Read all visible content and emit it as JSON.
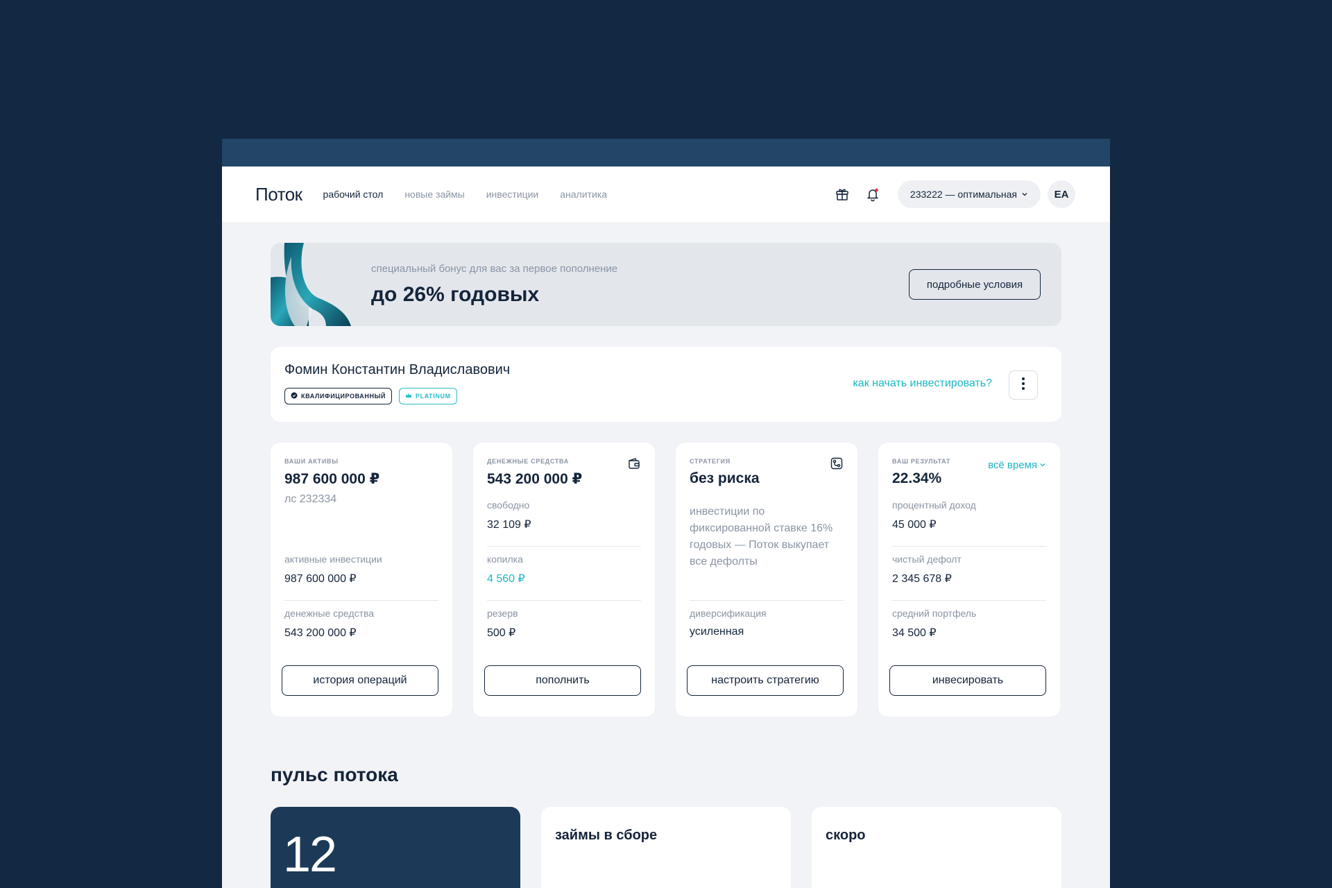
{
  "nav": {
    "logo": "Поток",
    "links": [
      "рабочий стол",
      "новые займы",
      "инвестиции",
      "аналитика"
    ],
    "account": "233222 — оптимальная",
    "avatar": "ЕА"
  },
  "banner": {
    "subtitle": "специальный бонус для вас за первое пополнение",
    "title": "до 26% годовых",
    "button": "подробные условия"
  },
  "user": {
    "name": "Фомин Константин Владиславович",
    "badge_qualified": "квалифицированный",
    "badge_platinum": "platinum",
    "how_link": "как начать инвестировать?"
  },
  "cards": {
    "assets": {
      "label": "ваши активы",
      "value": "987 600 000 ₽",
      "sub": "лс 232334",
      "row1_label": "активные инвестиции",
      "row1_value": "987 600 000 ₽",
      "row2_label": "денежные средства",
      "row2_value": "543 200 000 ₽",
      "button": "история операций"
    },
    "cash": {
      "label": "денежные средства",
      "value": "543 200 000 ₽",
      "row1_label": "свободно",
      "row1_value": "32 109 ₽",
      "row2_label": "копилка",
      "row2_value": "4 560 ₽",
      "row3_label": "резерв",
      "row3_value": "500 ₽",
      "button": "пополнить"
    },
    "strategy": {
      "label": "стратегия",
      "value": "без риска",
      "description": "инвестиции по фиксированной ставке 16% годовых — Поток выкупает все дефолты",
      "row_label": "диверсификация",
      "row_value": "усиленная",
      "button": "настроить стратегию"
    },
    "result": {
      "label": "ваш результат",
      "period": "всё время",
      "value": "22.34%",
      "row1_label": "процентный доход",
      "row1_value": "45 000 ₽",
      "row2_label": "чистый дефолт",
      "row2_value": "2 345 678 ₽",
      "row3_label": "средний портфель",
      "row3_value": "34 500 ₽",
      "button": "инвесировать"
    }
  },
  "pulse": {
    "title": "пульс потока",
    "number": "12",
    "card2_title": "займы в сборе",
    "card3_title": "скоро"
  },
  "colors": {
    "background": "#132842",
    "header_strip": "#234567",
    "text": "#14243a",
    "accent": "#1ab6c4",
    "notification_dot": "#e5343b"
  },
  "icons": [
    "gift-icon",
    "bell-icon",
    "chevron-down-icon",
    "shield-check-icon",
    "crown-icon",
    "more-vertical-icon",
    "wallet-icon",
    "strategy-icon"
  ]
}
